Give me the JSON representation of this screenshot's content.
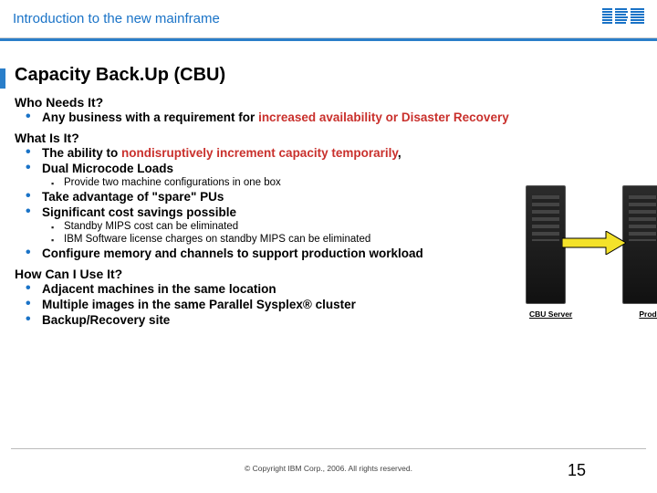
{
  "header": {
    "title": "Introduction to the new mainframe",
    "logo_alt": "IBM"
  },
  "slide": {
    "title": "Capacity Back.Up (CBU)"
  },
  "sections": {
    "who": {
      "heading": "Who Needs It?",
      "items": [
        {
          "prefix": "Any business with a requirement for ",
          "highlight": "increased availability or Disaster Recovery"
        }
      ]
    },
    "what": {
      "heading": "What Is It?",
      "items": [
        {
          "prefix": "The ability to ",
          "highlight": "nondisruptively increment capacity temporarily",
          "suffix": ","
        },
        {
          "prefix": "Dual Microcode Loads"
        }
      ],
      "sub1": [
        "Provide two machine configurations in one box"
      ],
      "items2": [
        "Take advantage of \"spare\" PUs",
        "Significant cost savings possible"
      ],
      "sub2": [
        "Standby MIPS cost can be eliminated",
        "IBM Software license charges on standby MIPS can be eliminated"
      ],
      "items3": [
        "Configure memory and channels to support production workload"
      ]
    },
    "how": {
      "heading": "How Can I Use It?",
      "items": [
        "Adjacent machines in the same location",
        "Multiple images in the same Parallel Sysplex® cluster",
        "Backup/Recovery site"
      ]
    }
  },
  "images": {
    "cbu_label": "CBU Server",
    "prod_label": "Production Se"
  },
  "footer": {
    "copyright": "© Copyright IBM Corp., 2006. All rights reserved.",
    "page": "15"
  }
}
